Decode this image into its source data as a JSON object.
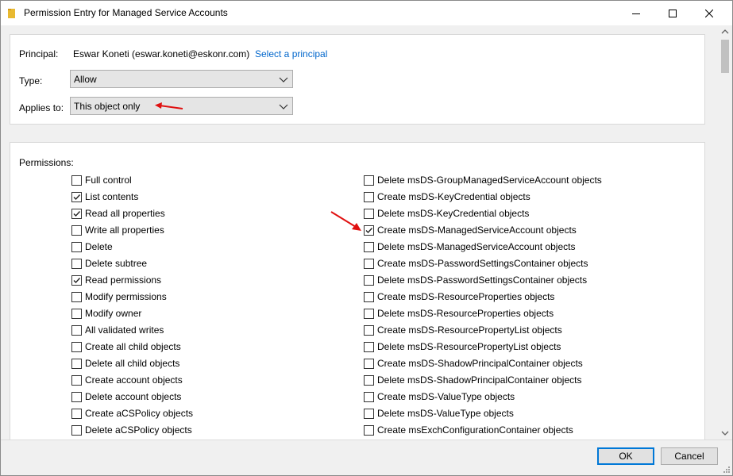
{
  "window": {
    "title": "Permission Entry for Managed Service Accounts"
  },
  "principal": {
    "label": "Principal:",
    "name": "Eswar Koneti (eswar.koneti@eskonr.com)",
    "link": "Select a principal"
  },
  "type": {
    "label": "Type:",
    "value": "Allow"
  },
  "applies_to": {
    "label": "Applies to:",
    "value": "This object only"
  },
  "permissions": {
    "label": "Permissions:",
    "left": [
      {
        "label": "Full control",
        "checked": false
      },
      {
        "label": "List contents",
        "checked": true
      },
      {
        "label": "Read all properties",
        "checked": true
      },
      {
        "label": "Write all properties",
        "checked": false
      },
      {
        "label": "Delete",
        "checked": false
      },
      {
        "label": "Delete subtree",
        "checked": false
      },
      {
        "label": "Read permissions",
        "checked": true
      },
      {
        "label": "Modify permissions",
        "checked": false
      },
      {
        "label": "Modify owner",
        "checked": false
      },
      {
        "label": "All validated writes",
        "checked": false
      },
      {
        "label": "Create all child objects",
        "checked": false
      },
      {
        "label": "Delete all child objects",
        "checked": false
      },
      {
        "label": "Create account objects",
        "checked": false
      },
      {
        "label": "Delete account objects",
        "checked": false
      },
      {
        "label": "Create aCSPolicy objects",
        "checked": false
      },
      {
        "label": "Delete aCSPolicy objects",
        "checked": false
      }
    ],
    "right": [
      {
        "label": "Delete msDS-GroupManagedServiceAccount objects",
        "checked": false
      },
      {
        "label": "Create msDS-KeyCredential objects",
        "checked": false
      },
      {
        "label": "Delete msDS-KeyCredential objects",
        "checked": false
      },
      {
        "label": "Create msDS-ManagedServiceAccount objects",
        "checked": true
      },
      {
        "label": "Delete msDS-ManagedServiceAccount objects",
        "checked": false
      },
      {
        "label": "Create msDS-PasswordSettingsContainer objects",
        "checked": false
      },
      {
        "label": "Delete msDS-PasswordSettingsContainer objects",
        "checked": false
      },
      {
        "label": "Create msDS-ResourceProperties objects",
        "checked": false
      },
      {
        "label": "Delete msDS-ResourceProperties objects",
        "checked": false
      },
      {
        "label": "Create msDS-ResourcePropertyList objects",
        "checked": false
      },
      {
        "label": "Delete msDS-ResourcePropertyList objects",
        "checked": false
      },
      {
        "label": "Create msDS-ShadowPrincipalContainer objects",
        "checked": false
      },
      {
        "label": "Delete msDS-ShadowPrincipalContainer objects",
        "checked": false
      },
      {
        "label": "Create msDS-ValueType objects",
        "checked": false
      },
      {
        "label": "Delete msDS-ValueType objects",
        "checked": false
      },
      {
        "label": "Create msExchConfigurationContainer objects",
        "checked": false
      }
    ]
  },
  "buttons": {
    "ok": "OK",
    "cancel": "Cancel"
  },
  "colors": {
    "link": "#0066cc",
    "annotation_arrow": "#e01010",
    "default_button_border": "#0078d7"
  }
}
